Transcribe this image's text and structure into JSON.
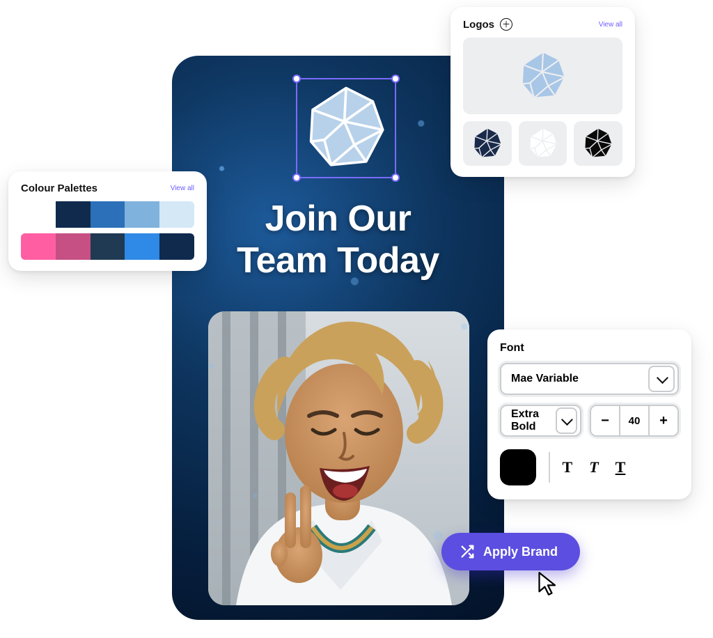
{
  "canvas": {
    "headline": "Join Our\nTeam Today"
  },
  "logos_panel": {
    "title": "Logos",
    "view_all": "View all",
    "featured_color": "#a8c6e6",
    "variants": [
      "#1a2a4a",
      "#ffffff",
      "#0a0a0a"
    ]
  },
  "palettes_panel": {
    "title": "Colour Palettes",
    "view_all": "View all",
    "rows": [
      [
        "#ffffff",
        "#0f2a4d",
        "#2b70b8",
        "#7fb2dd",
        "#d4e8f6"
      ],
      [
        "#ff5fa2",
        "#c65083",
        "#1f3a52",
        "#2e8ae6",
        "#0f2a4d"
      ]
    ]
  },
  "font_panel": {
    "title": "Font",
    "family": "Mae Variable",
    "weight": "Extra Bold",
    "size": "40",
    "color": "#000000"
  },
  "apply_button": {
    "label": "Apply Brand"
  }
}
